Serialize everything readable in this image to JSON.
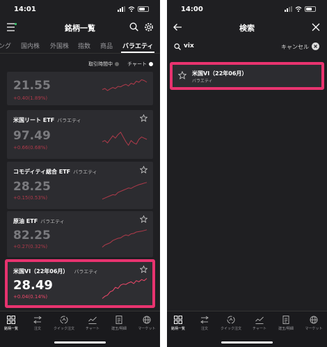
{
  "left": {
    "status_time": "14:01",
    "title": "銘柄一覧",
    "tabs": [
      "ング",
      "国内株",
      "外国株",
      "指数",
      "商品",
      "バラエティ"
    ],
    "toggles": {
      "trading_hours": "取引時間中",
      "chart": "チャート"
    },
    "cards": [
      {
        "name": "",
        "category": "",
        "price": "21.55",
        "change": "+0.40(1.89%)",
        "spark": [
          0.55,
          0.5,
          0.6,
          0.52,
          0.45,
          0.5,
          0.4,
          0.42,
          0.35,
          0.3,
          0.38,
          0.25,
          0.3,
          0.15,
          0.2,
          0.08,
          0.12,
          0.2
        ]
      },
      {
        "name": "米国リート ETF",
        "category": "バラエティ",
        "price": "97.49",
        "change": "+0.66(0.68%)",
        "spark": [
          0.6,
          0.55,
          0.65,
          0.5,
          0.35,
          0.45,
          0.3,
          0.2,
          0.4,
          0.6,
          0.75,
          0.55,
          0.65,
          0.7,
          0.5,
          0.4,
          0.45,
          0.5
        ]
      },
      {
        "name": "コモディティ総合 ETF",
        "category": "バラエティ",
        "price": "28.25",
        "change": "+0.15(0.53%)",
        "spark": [
          0.9,
          0.85,
          0.8,
          0.75,
          0.7,
          0.72,
          0.6,
          0.55,
          0.5,
          0.45,
          0.4,
          0.42,
          0.35,
          0.3,
          0.25,
          0.22,
          0.18,
          0.15
        ]
      },
      {
        "name": "原油 ETF",
        "category": "バラエティ",
        "price": "82.25",
        "change": "+0.27(0.32%)",
        "spark": [
          0.9,
          0.8,
          0.75,
          0.7,
          0.6,
          0.55,
          0.5,
          0.48,
          0.4,
          0.35,
          0.38,
          0.3,
          0.28,
          0.22,
          0.2,
          0.18,
          0.15,
          0.12
        ]
      },
      {
        "name": "米国VI（22年06月）",
        "category": "バラエティ",
        "price": "28.49",
        "change": "+0.04(0.14%)",
        "spark": [
          0.95,
          0.85,
          0.8,
          0.65,
          0.6,
          0.45,
          0.5,
          0.35,
          0.3,
          0.32,
          0.25,
          0.2,
          0.28,
          0.15,
          0.2,
          0.1,
          0.15,
          0.05
        ]
      }
    ],
    "bottom_nav": [
      "銘柄一覧",
      "注文",
      "クイック注文",
      "チャート",
      "建玉/明細",
      "マーケット"
    ]
  },
  "right": {
    "status_time": "14:00",
    "title": "検索",
    "search_value": "vix",
    "cancel_label": "キャンセル",
    "result": {
      "name": "米国VI（22年06月）",
      "category": "バラエティ"
    },
    "bottom_nav": [
      "銘柄一覧",
      "注文",
      "クイック注文",
      "チャート",
      "建玉/明細",
      "マーケット"
    ]
  },
  "colors": {
    "accent": "#e8336f",
    "positive": "#f0486a",
    "spark": "#b03a4a",
    "toggle_on": "#ffffff",
    "toggle_off": "#666666",
    "badge": "#3cc36e"
  }
}
